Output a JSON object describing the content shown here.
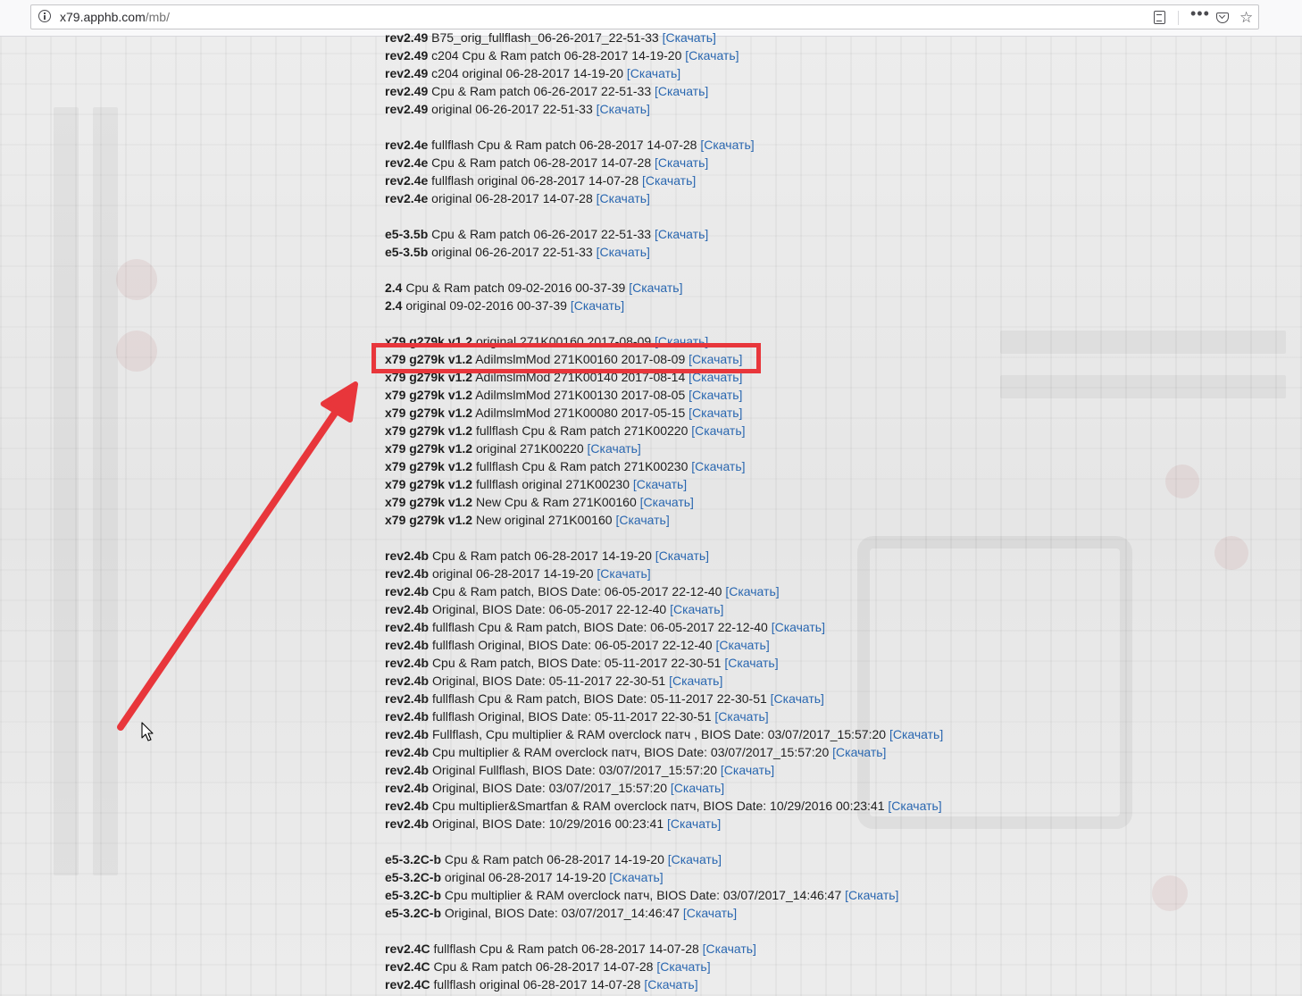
{
  "browser": {
    "url_host": "x79.apphb.com",
    "url_path": "/mb/"
  },
  "download_label": "[Скачать]",
  "groups": [
    {
      "lines": [
        {
          "ver": "rev2.49",
          "desc": "B75_orig_fullflash_06-26-2017_22-51-33"
        },
        {
          "ver": "rev2.49",
          "desc": "c204 Cpu & Ram patch 06-28-2017 14-19-20"
        },
        {
          "ver": "rev2.49",
          "desc": "c204 original 06-28-2017 14-19-20"
        },
        {
          "ver": "rev2.49",
          "desc": "Cpu & Ram patch 06-26-2017 22-51-33"
        },
        {
          "ver": "rev2.49",
          "desc": "original 06-26-2017 22-51-33"
        }
      ]
    },
    {
      "lines": [
        {
          "ver": "rev2.4e",
          "desc": "fullflash Cpu & Ram patch 06-28-2017 14-07-28"
        },
        {
          "ver": "rev2.4e",
          "desc": "Cpu & Ram patch 06-28-2017 14-07-28"
        },
        {
          "ver": "rev2.4e",
          "desc": "fullflash original 06-28-2017 14-07-28"
        },
        {
          "ver": "rev2.4e",
          "desc": "original 06-28-2017 14-07-28"
        }
      ]
    },
    {
      "lines": [
        {
          "ver": "e5-3.5b",
          "desc": "Cpu & Ram patch 06-26-2017 22-51-33"
        },
        {
          "ver": "e5-3.5b",
          "desc": "original 06-26-2017 22-51-33"
        }
      ]
    },
    {
      "lines": [
        {
          "ver": "2.4",
          "desc": "Cpu & Ram patch 09-02-2016 00-37-39"
        },
        {
          "ver": "2.4",
          "desc": "original 09-02-2016 00-37-39"
        }
      ]
    },
    {
      "lines": [
        {
          "ver": "x79 g279k v1.2",
          "desc": "original 271K00160 2017-08-09"
        },
        {
          "ver": "x79 g279k v1.2",
          "desc": "AdilmslmMod 271K00160 2017-08-09",
          "highlighted": true
        },
        {
          "ver": "x79 g279k v1.2",
          "desc": "AdilmslmMod 271K00140 2017-08-14"
        },
        {
          "ver": "x79 g279k v1.2",
          "desc": "AdilmslmMod 271K00130 2017-08-05"
        },
        {
          "ver": "x79 g279k v1.2",
          "desc": "AdilmslmMod 271K00080 2017-05-15"
        },
        {
          "ver": "x79 g279k v1.2",
          "desc": "fullflash Cpu & Ram patch 271K00220"
        },
        {
          "ver": "x79 g279k v1.2",
          "desc": "original 271K00220"
        },
        {
          "ver": "x79 g279k v1.2",
          "desc": "fullflash Cpu & Ram patch 271K00230"
        },
        {
          "ver": "x79 g279k v1.2",
          "desc": "fullflash original 271K00230"
        },
        {
          "ver": "x79 g279k v1.2",
          "desc": "New Cpu & Ram 271K00160"
        },
        {
          "ver": "x79 g279k v1.2",
          "desc": "New original 271K00160"
        }
      ]
    },
    {
      "lines": [
        {
          "ver": "rev2.4b",
          "desc": "Cpu & Ram patch 06-28-2017 14-19-20"
        },
        {
          "ver": "rev2.4b",
          "desc": "original 06-28-2017 14-19-20"
        },
        {
          "ver": "rev2.4b",
          "desc": "Cpu & Ram patch, BIOS Date: 06-05-2017 22-12-40"
        },
        {
          "ver": "rev2.4b",
          "desc": "Original, BIOS Date: 06-05-2017 22-12-40"
        },
        {
          "ver": "rev2.4b",
          "desc": "fullflash Cpu & Ram patch, BIOS Date: 06-05-2017 22-12-40"
        },
        {
          "ver": "rev2.4b",
          "desc": "fullflash Original, BIOS Date: 06-05-2017 22-12-40"
        },
        {
          "ver": "rev2.4b",
          "desc": "Cpu & Ram patch, BIOS Date: 05-11-2017 22-30-51"
        },
        {
          "ver": "rev2.4b",
          "desc": "Original, BIOS Date: 05-11-2017 22-30-51"
        },
        {
          "ver": "rev2.4b",
          "desc": "fullflash Cpu & Ram patch, BIOS Date: 05-11-2017 22-30-51"
        },
        {
          "ver": "rev2.4b",
          "desc": "fullflash Original, BIOS Date: 05-11-2017 22-30-51"
        },
        {
          "ver": "rev2.4b",
          "desc": "Fullflash, Cpu multiplier & RAM overclock патч , BIOS Date: 03/07/2017_15:57:20"
        },
        {
          "ver": "rev2.4b",
          "desc": "Cpu multiplier & RAM overclock патч, BIOS Date: 03/07/2017_15:57:20"
        },
        {
          "ver": "rev2.4b",
          "desc": "Original Fullflash, BIOS Date: 03/07/2017_15:57:20"
        },
        {
          "ver": "rev2.4b",
          "desc": "Original, BIOS Date: 03/07/2017_15:57:20"
        },
        {
          "ver": "rev2.4b",
          "desc": "Cpu multiplier&Smartfan & RAM overclock патч, BIOS Date: 10/29/2016 00:23:41"
        },
        {
          "ver": "rev2.4b",
          "desc": "Original, BIOS Date: 10/29/2016 00:23:41"
        }
      ]
    },
    {
      "lines": [
        {
          "ver": "e5-3.2C-b",
          "desc": "Cpu & Ram patch 06-28-2017 14-19-20"
        },
        {
          "ver": "e5-3.2C-b",
          "desc": "original 06-28-2017 14-19-20"
        },
        {
          "ver": "e5-3.2C-b",
          "desc": "Cpu multiplier & RAM overclock патч, BIOS Date: 03/07/2017_14:46:47"
        },
        {
          "ver": "e5-3.2C-b",
          "desc": "Original, BIOS Date: 03/07/2017_14:46:47"
        }
      ]
    },
    {
      "lines": [
        {
          "ver": "rev2.4C",
          "desc": "fullflash Cpu & Ram patch 06-28-2017 14-07-28"
        },
        {
          "ver": "rev2.4C",
          "desc": "Cpu & Ram patch 06-28-2017 14-07-28"
        },
        {
          "ver": "rev2.4C",
          "desc": "fullflash original 06-28-2017 14-07-28"
        }
      ]
    }
  ],
  "colors": {
    "link": "#2a67b0",
    "highlight": "#e8363b"
  }
}
